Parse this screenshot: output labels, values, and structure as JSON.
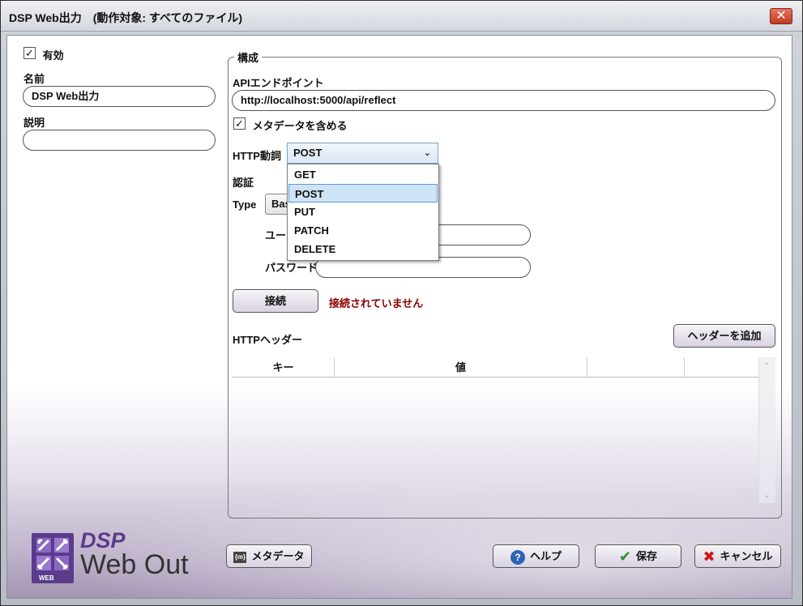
{
  "window": {
    "title": "DSP Web出力　(動作対象: すべてのファイル)",
    "close_glyph": "✕"
  },
  "left": {
    "enabled_label": "有効",
    "enabled_checked": true,
    "name_label": "名前",
    "name_value": "DSP Web出力",
    "description_label": "説明",
    "description_value": ""
  },
  "config": {
    "group_title": "構成",
    "endpoint_label": "APIエンドポイント",
    "endpoint_value": "http://localhost:5000/api/reflect",
    "include_metadata_label": "メタデータを含める",
    "include_metadata_checked": true,
    "http_verb_label": "HTTP動詞",
    "http_verb_value": "POST",
    "http_verb_options": [
      "GET",
      "POST",
      "PUT",
      "PATCH",
      "DELETE"
    ],
    "auth_label": "認証",
    "type_label": "Type",
    "type_value_visible": "Bas",
    "user_label_visible": "ユー",
    "password_label": "パスワード",
    "user_value": "",
    "password_value": "",
    "connect_button": "接続",
    "connection_status": "接続されていません",
    "connection_status_color": "#8b0000",
    "http_headers_label": "HTTPヘッダー",
    "add_header_button": "ヘッダーを追加",
    "table_columns": [
      "キー",
      "値",
      "",
      ""
    ]
  },
  "footer": {
    "metadata_button": "メタデータ",
    "help_button": "ヘルプ",
    "save_button": "保存",
    "cancel_button": "キャンセル"
  },
  "logo": {
    "dsp": "DSP",
    "web_out": "Web Out",
    "badge": "WEB",
    "accent_color": "#5b3b8c"
  }
}
